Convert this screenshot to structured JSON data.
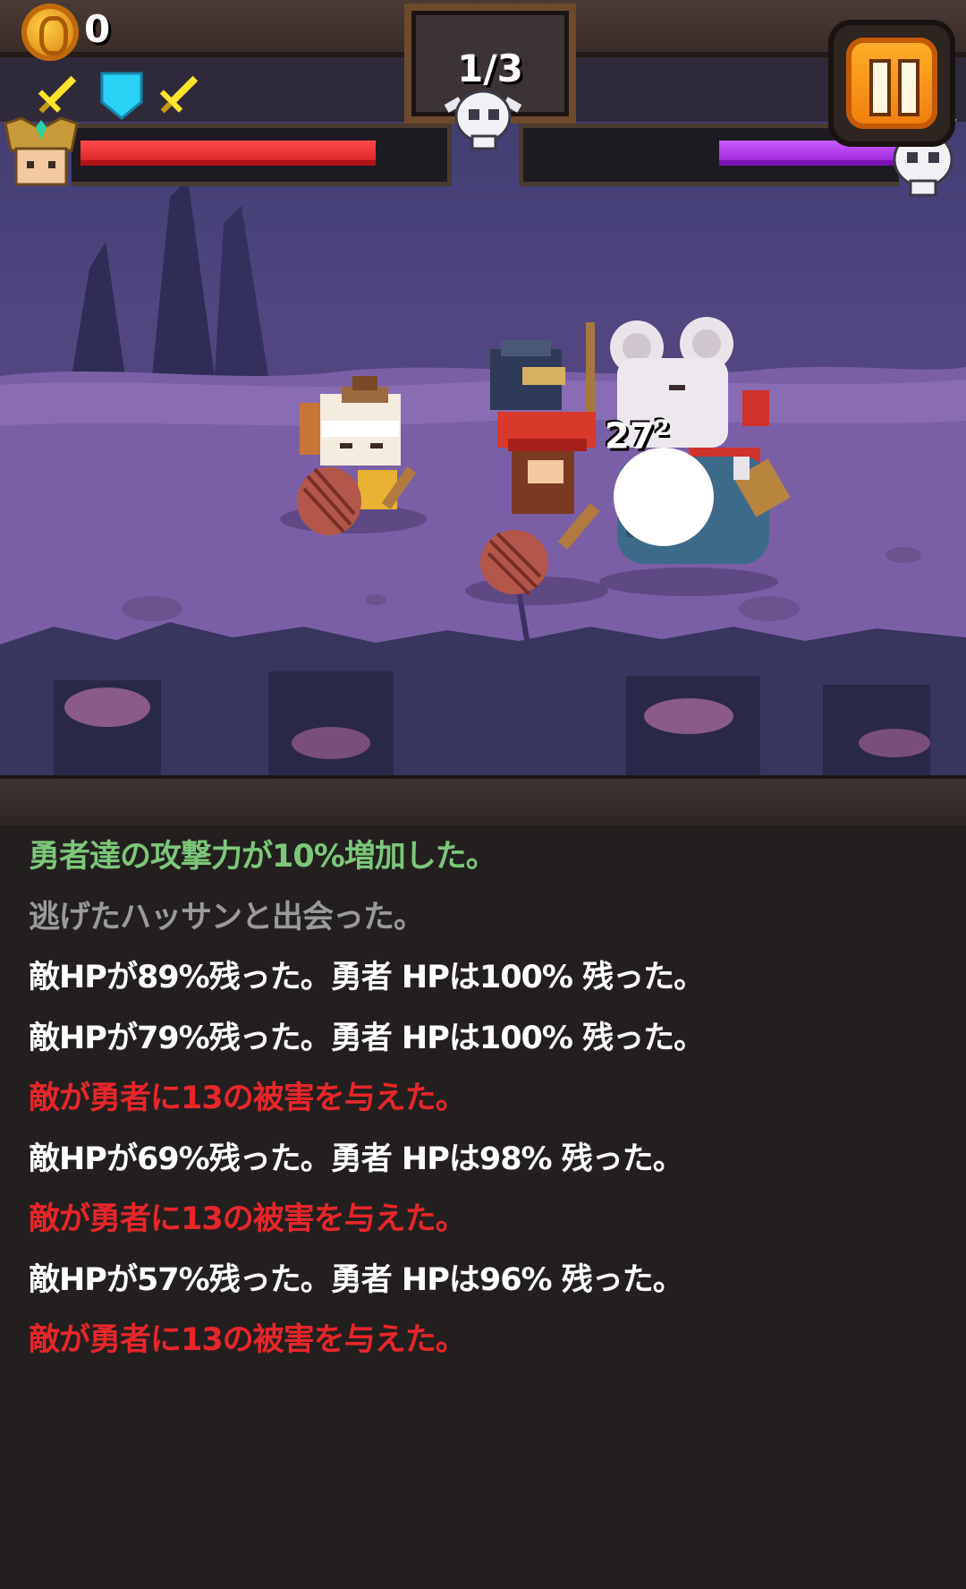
{
  "hud": {
    "coins": "0",
    "wave": "1/3",
    "hero_hp_percent": 96,
    "enemy_hp_percent": 57,
    "buffs": [
      "sword-icon",
      "shield-icon",
      "sword-icon"
    ],
    "colors": {
      "hero_hp": "#e0222a",
      "enemy_hp": "#a52ae0",
      "pause_orange": "#f7930f"
    }
  },
  "battle": {
    "damage_number": "27",
    "damage_superscript": "2"
  },
  "log": {
    "lines": [
      {
        "text": "勇者達の攻撃力が10%増加した。",
        "color": "#7cc779"
      },
      {
        "text": "逃げたハッサンと出会った。",
        "color": "#9a9a9a"
      },
      {
        "text": "敵HPが89%残った。勇者 HPは100% 残った。",
        "color": "#ffffff"
      },
      {
        "text": "敵HPが79%残った。勇者 HPは100% 残った。",
        "color": "#ffffff"
      },
      {
        "text": "敵が勇者に13の被害を与えた。",
        "color": "#e8262a"
      },
      {
        "text": "敵HPが69%残った。勇者 HPは98% 残った。",
        "color": "#ffffff"
      },
      {
        "text": "敵が勇者に13の被害を与えた。",
        "color": "#e8262a"
      },
      {
        "text": "敵HPが57%残った。勇者 HPは96% 残った。",
        "color": "#ffffff"
      },
      {
        "text": "敵が勇者に13の被害を与えた。",
        "color": "#e8262a"
      }
    ]
  }
}
